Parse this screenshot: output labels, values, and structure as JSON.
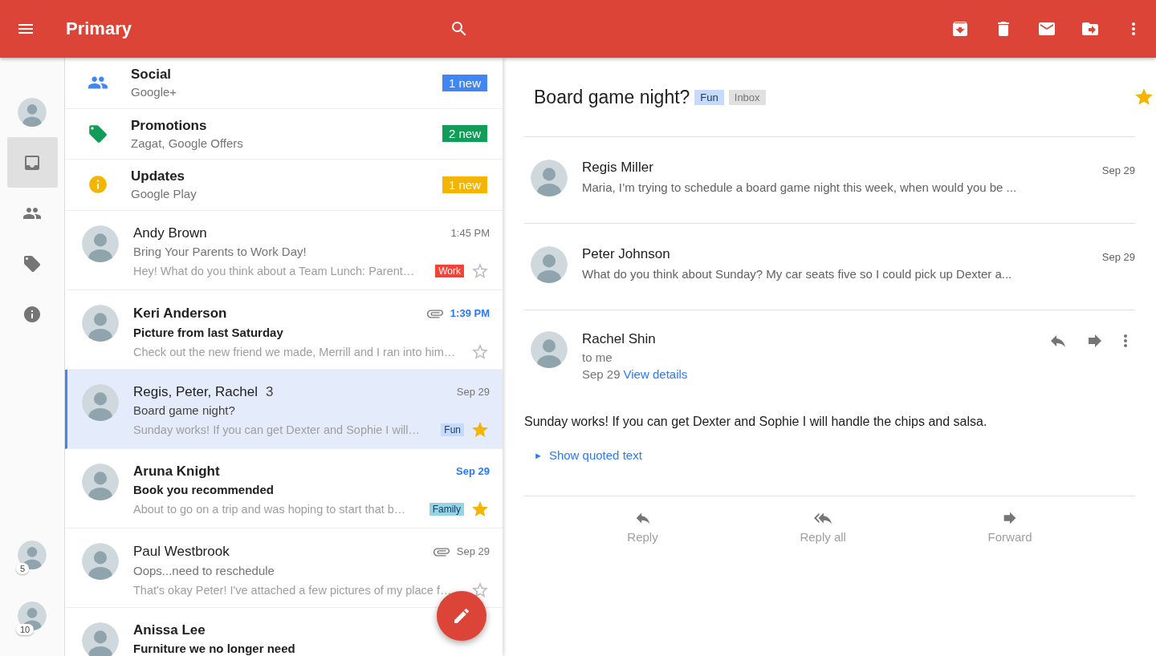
{
  "toolbar": {
    "title": "Primary"
  },
  "rail": {
    "items": [
      {
        "kind": "avatar",
        "selected": false
      },
      {
        "kind": "inbox",
        "selected": true
      },
      {
        "kind": "people",
        "selected": false
      },
      {
        "kind": "label",
        "selected": false
      },
      {
        "kind": "info",
        "selected": false
      }
    ],
    "accounts": [
      {
        "count": "5"
      },
      {
        "count": "10"
      }
    ]
  },
  "categories": [
    {
      "kind": "social",
      "name": "Social",
      "detail": "Google+",
      "badge": "1 new",
      "color": "#4285f4"
    },
    {
      "kind": "promotions",
      "name": "Promotions",
      "detail": "Zagat, Google Offers",
      "badge": "2 new",
      "color": "#0f9d58"
    },
    {
      "kind": "updates",
      "name": "Updates",
      "detail": "Google Play",
      "badge": "1 new",
      "color": "#f4b400"
    }
  ],
  "emails": [
    {
      "sender": "Andy Brown",
      "subject": "Bring Your Parents to Work Day!",
      "snippet": "Hey! What do you think about a Team Lunch: Parent…",
      "time": "1:45 PM",
      "unread": false,
      "attachment": false,
      "label": {
        "text": "Work",
        "color": "#f44336"
      },
      "starred": false,
      "selected": false
    },
    {
      "sender": "Keri Anderson",
      "subject": "Picture from last Saturday",
      "snippet": "Check out the new friend we made, Merrill and I ran into him…",
      "time": "1:39 PM",
      "unread": true,
      "attachment": true,
      "starred": false,
      "selected": false
    },
    {
      "sender": "Regis, Peter, Rachel",
      "count": "3",
      "subject": "Board game night?",
      "snippet": "Sunday works! If you can get Dexter and Sophie I will…",
      "time": "Sep 29",
      "unread": false,
      "attachment": false,
      "label": {
        "text": "Fun",
        "color": "#c6dafc"
      },
      "starred": true,
      "selected": true
    },
    {
      "sender": "Aruna Knight",
      "subject": "Book you recommended",
      "snippet": "About to go on a trip and was hoping to start that b…",
      "time": "Sep 29",
      "unread": true,
      "attachment": false,
      "label": {
        "text": "Family",
        "color": "#93d6e2"
      },
      "starred": true,
      "selected": false
    },
    {
      "sender": "Paul Westbrook",
      "subject": "Oops...need to reschedule",
      "snippet": "That's okay Peter! I've attached a few pictures of my place f…",
      "time": "Sep 29",
      "unread": false,
      "attachment": true,
      "starred": false,
      "selected": false
    },
    {
      "sender": "Anissa Lee",
      "subject": "Furniture we no longer need",
      "unread": true,
      "attachment": false,
      "selected": false
    }
  ],
  "detail": {
    "title": "Board game night?",
    "labels": [
      {
        "text": "Fun",
        "color": "#c6dafc"
      },
      {
        "text": "Inbox",
        "color": "#e0e0e0"
      }
    ],
    "starred": true,
    "collapsed": [
      {
        "sender": "Regis Miller",
        "snippet": "Maria, I’m trying to schedule a board game night this week, when would you be ...",
        "date": "Sep 29"
      },
      {
        "sender": "Peter Johnson",
        "snippet": "What do you think about Sunday? My car seats five so I could pick up Dexter a...",
        "date": "Sep 29"
      }
    ],
    "open": {
      "sender": "Rachel Shin",
      "recipient": "to me",
      "date": "Sep 29",
      "details_link": "View details",
      "body": "Sunday works! If you can get Dexter and Sophie I will handle the chips and salsa.",
      "quoted_toggle": "►",
      "quoted_link": "Show quoted text"
    },
    "actions": [
      {
        "kind": "reply",
        "label": "Reply"
      },
      {
        "kind": "reply-all",
        "label": "Reply all"
      },
      {
        "kind": "forward",
        "label": "Forward"
      }
    ]
  }
}
